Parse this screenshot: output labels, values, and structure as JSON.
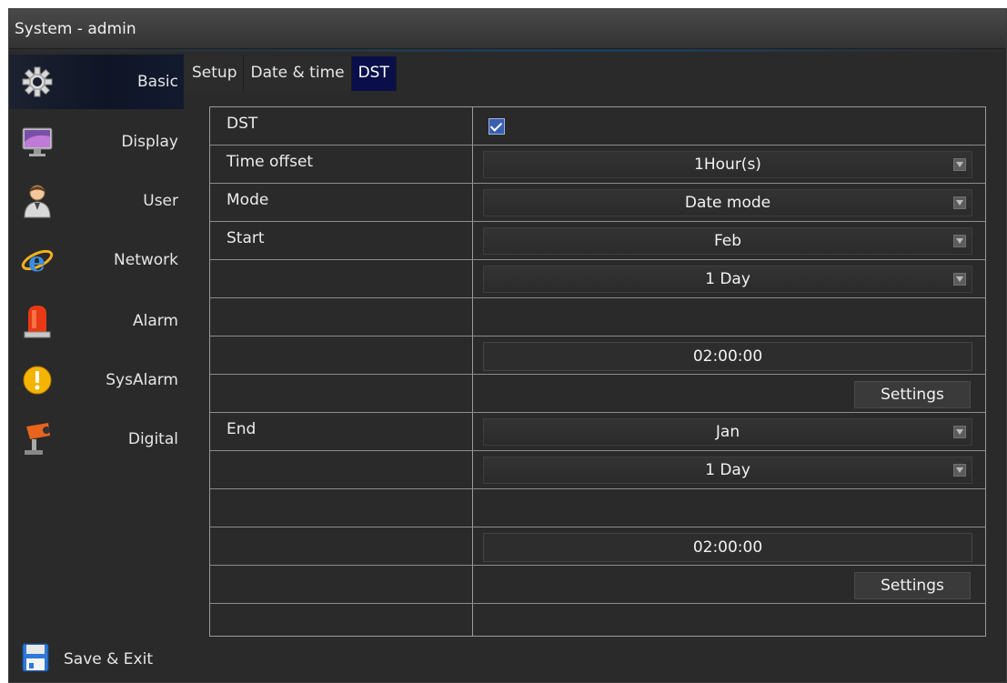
{
  "window": {
    "title": "System - admin"
  },
  "sidebar": {
    "items": [
      {
        "label": "Basic",
        "icon": "gear-icon",
        "active": true
      },
      {
        "label": "Display",
        "icon": "monitor-icon"
      },
      {
        "label": "User",
        "icon": "user-icon"
      },
      {
        "label": "Network",
        "icon": "network-icon"
      },
      {
        "label": "Alarm",
        "icon": "alarm-light-icon"
      },
      {
        "label": "SysAlarm",
        "icon": "warning-icon"
      },
      {
        "label": "Digital",
        "icon": "camera-icon"
      }
    ],
    "save_exit": {
      "label": "Save & Exit",
      "icon": "floppy-disk-icon"
    }
  },
  "tabs": [
    {
      "label": "Setup"
    },
    {
      "label": "Date & time"
    },
    {
      "label": "DST",
      "active": true
    }
  ],
  "form": {
    "dst_label": "DST",
    "dst_checked": true,
    "time_offset_label": "Time offset",
    "time_offset_value": "1Hour(s)",
    "mode_label": "Mode",
    "mode_value": "Date mode",
    "start_label": "Start",
    "start_month": "Feb",
    "start_day": "1 Day",
    "start_time": "02:00:00",
    "start_settings": "Settings",
    "end_label": "End",
    "end_month": "Jan",
    "end_day": "1 Day",
    "end_time": "02:00:00",
    "end_settings": "Settings"
  },
  "colors": {
    "window_bg": "#2a2a2a",
    "active_tab": "#0a0f4a",
    "checkbox": "#3a5fb0",
    "grid_line": "#9a9a9a"
  }
}
